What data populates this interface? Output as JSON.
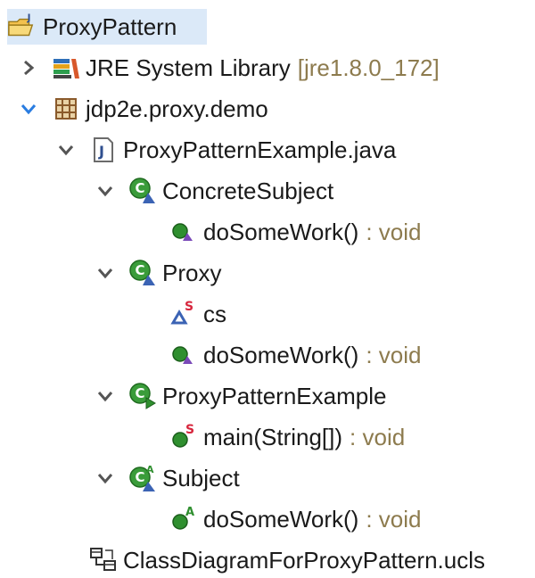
{
  "tree": {
    "project": {
      "label": "ProxyPattern",
      "icon": "java-project-icon"
    },
    "jre": {
      "label": "JRE System Library",
      "detail": "[jre1.8.0_172]",
      "icon": "library-icon",
      "chevron": "chevron-right-icon"
    },
    "package": {
      "label": "jdp2e.proxy.demo",
      "icon": "package-icon",
      "chevron": "chevron-down-icon"
    },
    "file": {
      "label": "ProxyPatternExample.java",
      "icon": "java-file-icon",
      "chevron": "chevron-down-icon"
    },
    "concrete_subject": {
      "label": "ConcreteSubject",
      "icon": "class-icon",
      "method": {
        "name": "doSomeWork()",
        "type": ": void",
        "icon": "default-method-icon"
      }
    },
    "proxy": {
      "label": "Proxy",
      "icon": "class-icon",
      "field": {
        "name": "cs",
        "icon": "static-field-icon"
      },
      "method": {
        "name": "doSomeWork()",
        "type": ": void",
        "icon": "default-method-icon"
      }
    },
    "proxy_pattern_example": {
      "label": "ProxyPatternExample",
      "icon": "main-class-icon",
      "method": {
        "name": "main(String[])",
        "type": ": void",
        "icon": "static-public-method-icon"
      }
    },
    "subject": {
      "label": "Subject",
      "icon": "abstract-class-icon",
      "method": {
        "name": "doSomeWork()",
        "type": ": void",
        "icon": "abstract-public-method-icon"
      }
    },
    "diagram": {
      "label": "ClassDiagramForProxyPattern.ucls",
      "icon": "class-diagram-icon"
    }
  },
  "colors": {
    "selection": "#dbe9f8",
    "type_text": "#8d7b4e",
    "class_green": "#3a9c3a",
    "method_green": "#2f8f2f",
    "static_red": "#d7263d",
    "abstract_triangle": "#3b63b4",
    "package_brown": "#8a5a2b"
  }
}
